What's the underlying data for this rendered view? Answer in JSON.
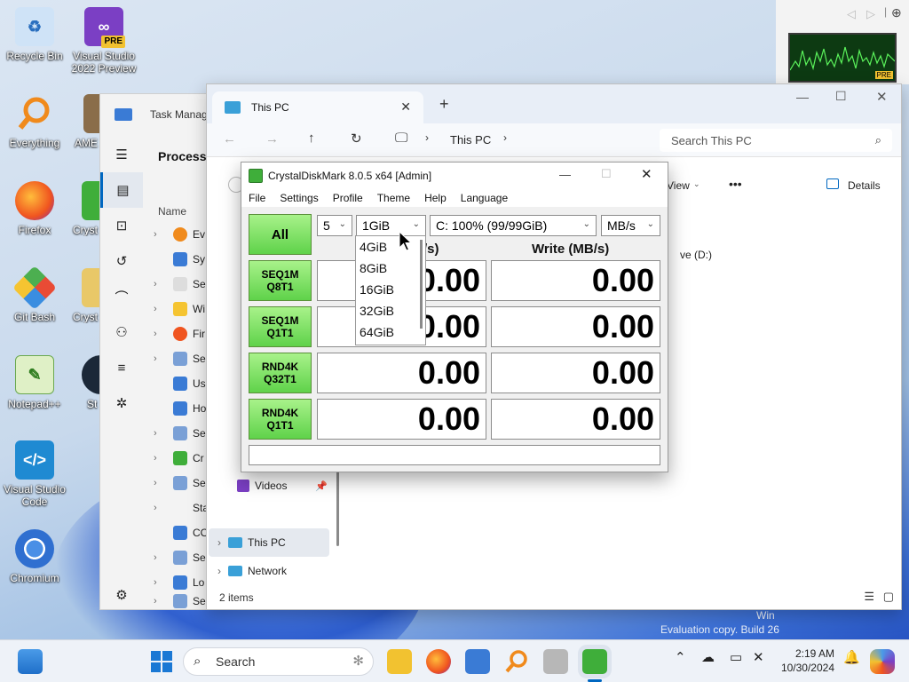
{
  "desktop": {
    "icons": [
      {
        "label": "Recycle Bin",
        "icon": "recycle-bin-icon"
      },
      {
        "label": "Visual Studio 2022 Preview",
        "icon": "visual-studio-icon",
        "badge": "PRE"
      },
      {
        "label": "Everything",
        "icon": "search-magnifier-icon"
      },
      {
        "label": "AME",
        "icon": "ame-icon"
      },
      {
        "label": "Firefox",
        "icon": "firefox-icon"
      },
      {
        "label": "Cryst",
        "icon": "crystal-icon"
      },
      {
        "label": "Git Bash",
        "icon": "git-icon"
      },
      {
        "label": "Cryst",
        "icon": "crystal-icon"
      },
      {
        "label": "Notepad++",
        "icon": "notepadpp-icon"
      },
      {
        "label": "St",
        "icon": "steam-icon"
      },
      {
        "label": "Visual Studio Code",
        "icon": "vscode-icon"
      },
      {
        "label": "Chromium",
        "icon": "chromium-icon"
      }
    ],
    "watermark": [
      "Win",
      "Evaluation copy. Build 26"
    ]
  },
  "task_manager": {
    "title": "Task Manag",
    "section": "Processe",
    "column_name": "Name",
    "rows": [
      "Ev",
      "Sy",
      "Se",
      "Wi",
      "Fir",
      "Se",
      "Us",
      "Ho",
      "Se",
      "Cr",
      "Se",
      "Sta",
      "CO",
      "Se",
      "Lo",
      "Se"
    ]
  },
  "explorer": {
    "tab_title": "This PC",
    "breadcrumb": [
      "This PC"
    ],
    "search_placeholder": "Search This PC",
    "toolbar": {
      "view": "View",
      "more": "•••",
      "details": "Details"
    },
    "nav_items": [
      {
        "label": "Videos",
        "pinned": true
      },
      {
        "label": "This PC",
        "selected": true
      },
      {
        "label": "Network"
      }
    ],
    "drive_fragment": "ve (D:)",
    "status": "2 items"
  },
  "cdm": {
    "title": "CrystalDiskMark 8.0.5 x64 [Admin]",
    "menu": [
      "File",
      "Settings",
      "Profile",
      "Theme",
      "Help",
      "Language"
    ],
    "all_button": "All",
    "count": "5",
    "size": "1GiB",
    "drive": "C: 100% (99/99GiB)",
    "unit": "MB/s",
    "read_header_fragment": "/s)",
    "write_header": "Write (MB/s)",
    "tests": [
      {
        "line1": "SEQ1M",
        "line2": "Q8T1",
        "read": "0.00",
        "write": "0.00"
      },
      {
        "line1": "SEQ1M",
        "line2": "Q1T1",
        "read": "0.00",
        "write": "0.00"
      },
      {
        "line1": "RND4K",
        "line2": "Q32T1",
        "read": "0.00",
        "write": "0.00"
      },
      {
        "line1": "RND4K",
        "line2": "Q1T1",
        "read": "0.00",
        "write": "0.00"
      }
    ],
    "comment": "",
    "size_options": [
      "4GiB",
      "8GiB",
      "16GiB",
      "32GiB",
      "64GiB"
    ]
  },
  "taskbar": {
    "search": "Search",
    "clock_time": "2:19 AM",
    "clock_date": "10/30/2024"
  },
  "colors": {
    "accent": "#0067c0",
    "cdm_green": "#5fd24a",
    "taskbar": "#eef2f8"
  }
}
